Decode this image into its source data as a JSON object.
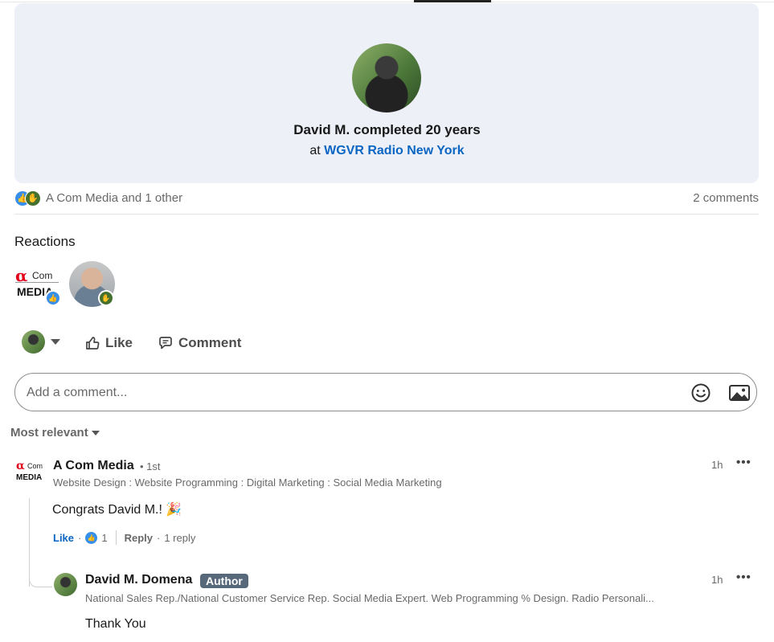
{
  "card": {
    "title": "David M. completed 20 years",
    "at": "at",
    "company": "WGVR Radio New York"
  },
  "social": {
    "reactors_text": "A Com Media and 1 other",
    "comments_count": "2 comments"
  },
  "reactions": {
    "heading": "Reactions",
    "logo_alpha": "α",
    "logo_com": "Com",
    "logo_media": "MEDIA"
  },
  "actions": {
    "like_label": "Like",
    "comment_label": "Comment"
  },
  "comment_box": {
    "placeholder": "Add a comment..."
  },
  "sort": {
    "label": "Most relevant"
  },
  "comments": [
    {
      "name": "A Com Media",
      "degree": "• 1st",
      "headline": "Website Design : Website Programming : Digital Marketing : Social Media Marketing",
      "time": "1h",
      "text": "Congrats David M.! 🎉",
      "like_label": "Like",
      "like_count": "1",
      "reply_label": "Reply",
      "reply_count": "1 reply",
      "more": "•••"
    },
    {
      "name": "David M. Domena",
      "badge": "Author",
      "headline": "National Sales Rep./National Customer Service Rep. Social Media Expert. Web Programming % Design. Radio Personali...",
      "time": "1h",
      "text": "Thank You",
      "more": "•••"
    }
  ],
  "colors": {
    "link": "#0a66c2",
    "card_bg": "#eef0f8",
    "like_blue": "#378fe9",
    "celebrate_green": "#44712e",
    "author_badge": "#56687a"
  }
}
